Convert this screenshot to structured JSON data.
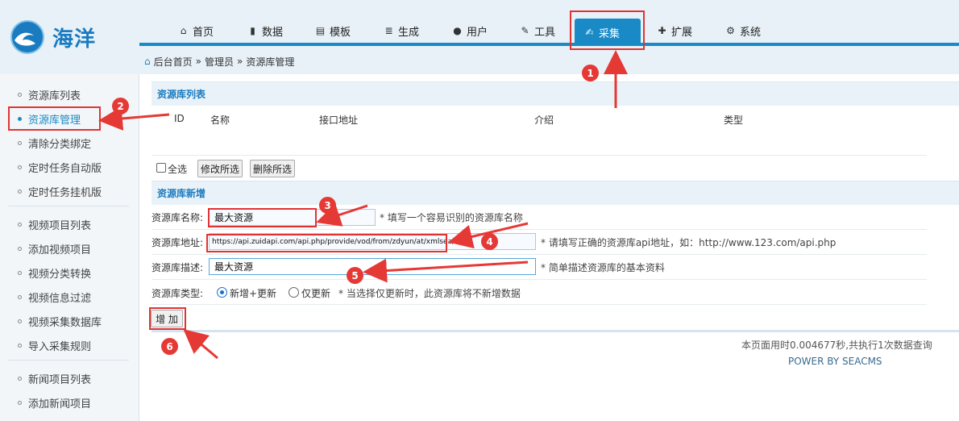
{
  "logo": {
    "text": "海洋"
  },
  "nav": {
    "items": [
      {
        "label": "首页",
        "icon": "home-icon"
      },
      {
        "label": "数据",
        "icon": "book-icon"
      },
      {
        "label": "模板",
        "icon": "file-icon"
      },
      {
        "label": "生成",
        "icon": "server-icon"
      },
      {
        "label": "用户",
        "icon": "user-icon"
      },
      {
        "label": "工具",
        "icon": "wrench-icon"
      },
      {
        "label": "采集",
        "icon": "edit-icon",
        "active": true
      },
      {
        "label": "扩展",
        "icon": "puzzle-icon"
      },
      {
        "label": "系统",
        "icon": "gear-icon"
      }
    ]
  },
  "breadcrumb": {
    "home": "后台首页",
    "sep": "»",
    "level1": "管理员",
    "level2": "资源库管理"
  },
  "sidebar": {
    "items": [
      {
        "label": "资源库列表"
      },
      {
        "label": "资源库管理",
        "active": true
      },
      {
        "label": "清除分类绑定"
      },
      {
        "label": "定时任务自动版"
      },
      {
        "label": "定时任务挂机版"
      },
      {
        "label": "视频项目列表"
      },
      {
        "label": "添加视频项目"
      },
      {
        "label": "视频分类转换"
      },
      {
        "label": "视频信息过滤"
      },
      {
        "label": "视频采集数据库"
      },
      {
        "label": "导入采集规则"
      },
      {
        "label": "新闻项目列表"
      },
      {
        "label": "添加新闻项目"
      }
    ]
  },
  "list": {
    "title": "资源库列表",
    "columns": [
      "ID",
      "名称",
      "接口地址",
      "介绍",
      "类型"
    ],
    "select_all": "全选",
    "modify_btn": "修改所选",
    "delete_btn": "删除所选"
  },
  "form": {
    "title": "资源库新增",
    "name_label": "资源库名称:",
    "name_value": "最大资源",
    "name_hint": "* 填写一个容易识别的资源库名称",
    "url_label": "资源库地址:",
    "url_value": "https://api.zuidapi.com/api.php/provide/vod/from/zdyun/at/xmlsea/",
    "url_hint": "* 请填写正确的资源库api地址，如：http://www.123.com/api.php",
    "desc_label": "资源库描述:",
    "desc_value": "最大资源",
    "desc_hint": "* 简单描述资源库的基本资料",
    "type_label": "资源库类型:",
    "type_opt1": "新增+更新",
    "type_opt2": "仅更新",
    "type_hint": "* 当选择仅更新时，此资源库将不新增数据",
    "submit": "增 加"
  },
  "footer": {
    "stats": "本页面用时0.004677秒,共执行1次数据查询",
    "power": "POWER BY SEACMS"
  },
  "annotations": {
    "color": "#e53935",
    "badges": [
      "1",
      "2",
      "3",
      "4",
      "5",
      "6"
    ]
  }
}
